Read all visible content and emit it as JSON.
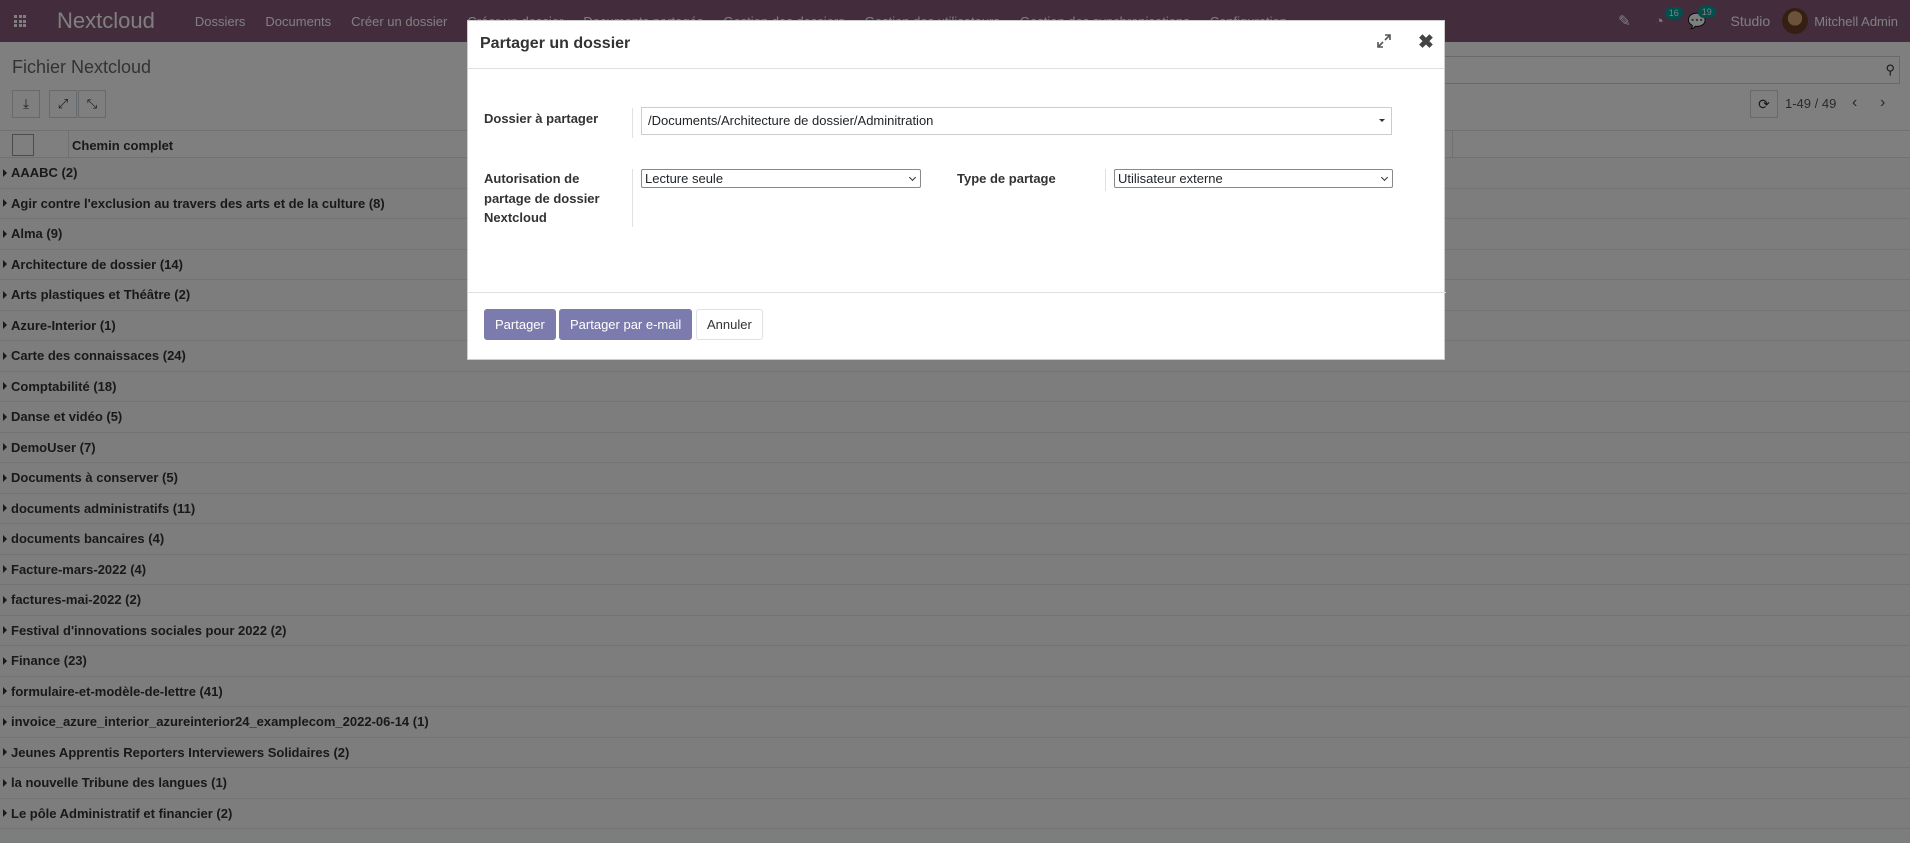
{
  "navbar": {
    "brand": "Nextcloud",
    "menu": [
      "Dossiers",
      "Documents",
      "Créer un dossier",
      "Créer un dossier",
      "Documents partagés",
      "Gestion des dossiers",
      "Gestion des utilisateurs",
      "Gestion des synchronisations",
      "Configuration"
    ],
    "activity_count": "16",
    "messages_count": "19",
    "studio_label": "Studio",
    "user_name": "Mitchell Admin"
  },
  "control_panel": {
    "title": "Fichier Nextcloud",
    "pager_value": "1-49 / 49"
  },
  "list": {
    "column_header": "Chemin complet",
    "groups": [
      "AAABC (2)",
      "Agir contre l'exclusion au travers des arts et de la culture (8)",
      "Alma (9)",
      "Architecture de dossier (14)",
      "Arts plastiques et Théâtre (2)",
      "Azure-Interior (1)",
      "Carte des connaissaces (24)",
      "Comptabilité (18)",
      "Danse et vidéo (5)",
      "DemoUser (7)",
      "Documents à conserver (5)",
      "documents administratifs (11)",
      "documents bancaires (4)",
      "Facture-mars-2022 (4)",
      "factures-mai-2022 (2)",
      "Festival d'innovations sociales pour 2022 (2)",
      "Finance (23)",
      "formulaire-et-modèle-de-lettre (41)",
      "invoice_azure_interior_azureinterior24_examplecom_2022-06-14 (1)",
      "Jeunes Apprentis Reporters Interviewers Solidaires (2)",
      "la nouvelle Tribune des langues (1)",
      "Le pôle Administratif et financier (2)"
    ]
  },
  "modal": {
    "title": "Partager un dossier",
    "folder_label": "Dossier à partager",
    "folder_value": "/Documents/Architecture de dossier/Adminitration",
    "permission_label": "Autorisation de partage de dossier Nextcloud",
    "permission_value": "Lecture seule",
    "share_type_label": "Type de partage",
    "share_type_value": "Utilisateur externe",
    "share_button": "Partager",
    "share_email_button": "Partager par e-mail",
    "cancel_button": "Annuler"
  }
}
